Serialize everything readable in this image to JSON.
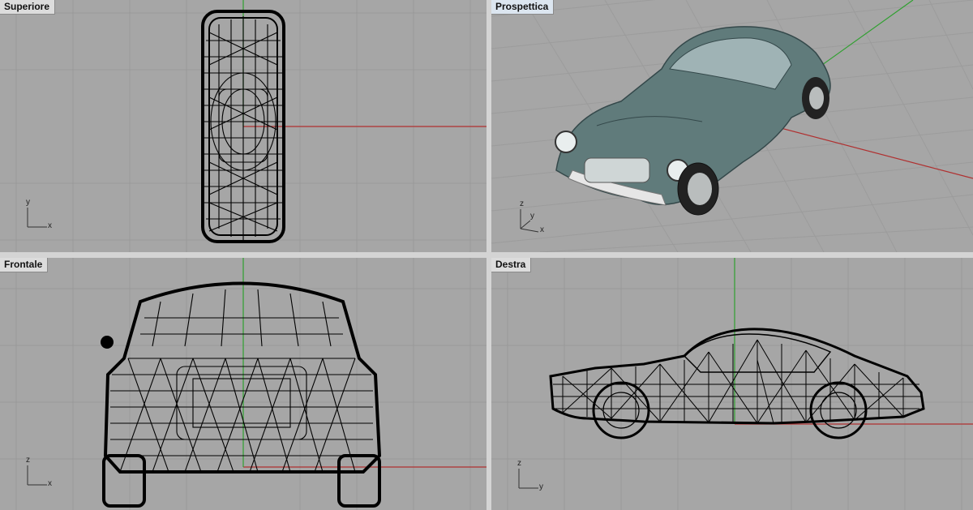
{
  "viewports": {
    "top": {
      "label": "Superiore"
    },
    "perspective": {
      "label": "Prospettica"
    },
    "front": {
      "label": "Frontale"
    },
    "right": {
      "label": "Destra"
    }
  },
  "axes": {
    "top": {
      "a": "y",
      "b": "x"
    },
    "perspective": {
      "a": "z",
      "b": "y",
      "c": "x"
    },
    "front": {
      "a": "z",
      "b": "x"
    },
    "right": {
      "a": "z",
      "b": "y"
    }
  },
  "colors": {
    "viewport_bg": "#a6a6a6",
    "grid_line": "#9a9a9a",
    "grid_major": "#8e8e8e",
    "x_axis": "#b03030",
    "y_axis": "#30a030",
    "wire": "#000000",
    "car_body": "#5f7a7a"
  }
}
